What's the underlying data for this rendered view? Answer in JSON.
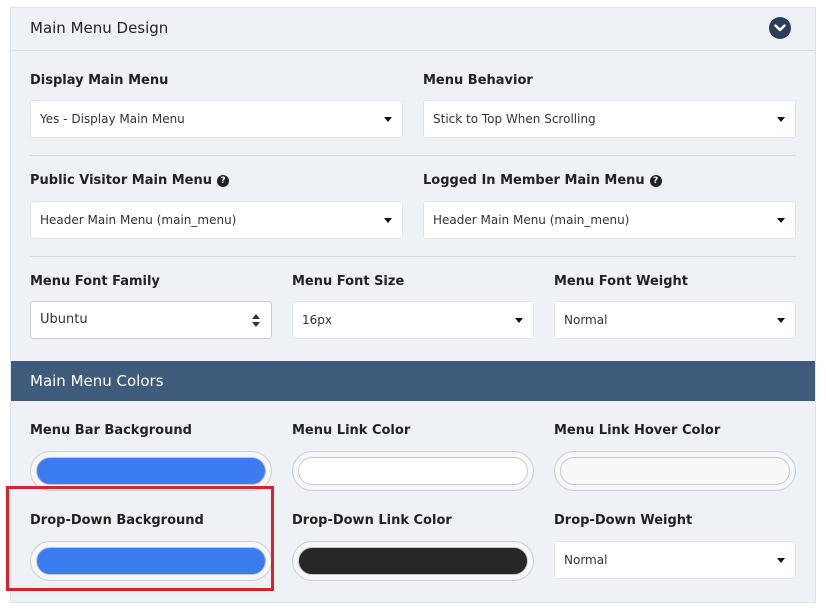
{
  "header": {
    "title": "Main Menu Design",
    "collapse_icon": "chevron-down-icon"
  },
  "menu_settings": {
    "display_main_menu": {
      "label": "Display Main Menu",
      "value": "Yes - Display Main Menu"
    },
    "menu_behavior": {
      "label": "Menu Behavior",
      "value": "Stick to Top When Scrolling"
    },
    "public_visitor_menu": {
      "label": "Public Visitor Main Menu",
      "value": "Header Main Menu (main_menu)",
      "help": "?"
    },
    "logged_in_menu": {
      "label": "Logged In Member Main Menu",
      "value": "Header Main Menu (main_menu)",
      "help": "?"
    },
    "font_family": {
      "label": "Menu Font Family",
      "value": "Ubuntu"
    },
    "font_size": {
      "label": "Menu Font Size",
      "value": "16px"
    },
    "font_weight": {
      "label": "Menu Font Weight",
      "value": "Normal"
    }
  },
  "colors_section": {
    "title": "Main Menu Colors",
    "bar_background": {
      "label": "Menu Bar Background",
      "color": "#3b7cf0"
    },
    "link_color": {
      "label": "Menu Link Color",
      "color": "#ffffff"
    },
    "link_hover_color": {
      "label": "Menu Link Hover Color",
      "color": "#f8f8f8"
    },
    "dropdown_background": {
      "label": "Drop-Down Background",
      "color": "#3b7cf0"
    },
    "dropdown_link_color": {
      "label": "Drop-Down Link Color",
      "color": "#272727"
    },
    "dropdown_weight": {
      "label": "Drop-Down Weight",
      "value": "Normal"
    }
  },
  "theme": {
    "section_bar": "#3f5b7b",
    "highlight_border": "#d8232a",
    "panel_bg": "#eef1f6"
  }
}
